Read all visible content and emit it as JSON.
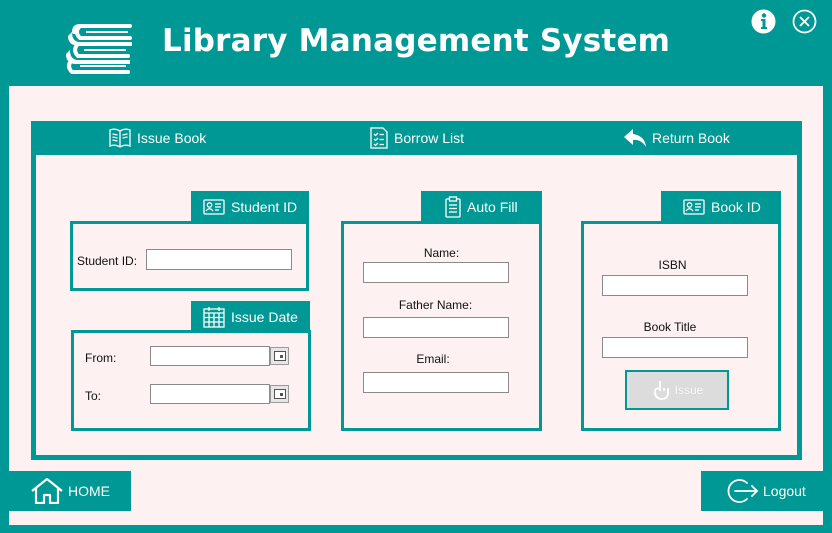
{
  "app": {
    "title": "Library Management System",
    "logo_icon": "books-stack-icon",
    "info_icon": "info-icon",
    "close_icon": "close-icon"
  },
  "colors": {
    "accent": "#009895",
    "panel_bg": "#fdf1f1",
    "white": "#ffffff"
  },
  "tabs": [
    {
      "label": "Issue Book",
      "icon": "open-book-icon"
    },
    {
      "label": "Borrow List",
      "icon": "checklist-icon"
    },
    {
      "label": "Return Book",
      "icon": "reply-arrow-icon"
    }
  ],
  "student_group": {
    "title": "Student ID",
    "icon": "id-card-icon",
    "student_id_label": "Student ID:",
    "student_id_value": ""
  },
  "date_group": {
    "title": "Issue Date",
    "icon": "calendar-icon",
    "from_label": "From:",
    "to_label": "To:",
    "from_value": "",
    "to_value": ""
  },
  "autofill_group": {
    "title": "Auto Fill",
    "icon": "clipboard-icon",
    "name_label": "Name:",
    "father_label": "Father Name:",
    "email_label": "Email:",
    "name_value": "",
    "father_value": "",
    "email_value": ""
  },
  "book_group": {
    "title": "Book ID",
    "icon": "id-card-icon",
    "isbn_label": "ISBN",
    "book_title_label": "Book Title",
    "isbn_value": "",
    "book_title_value": "",
    "issue_label": "Issue"
  },
  "footer": {
    "home_label": "HOME",
    "logout_label": "Logout"
  }
}
